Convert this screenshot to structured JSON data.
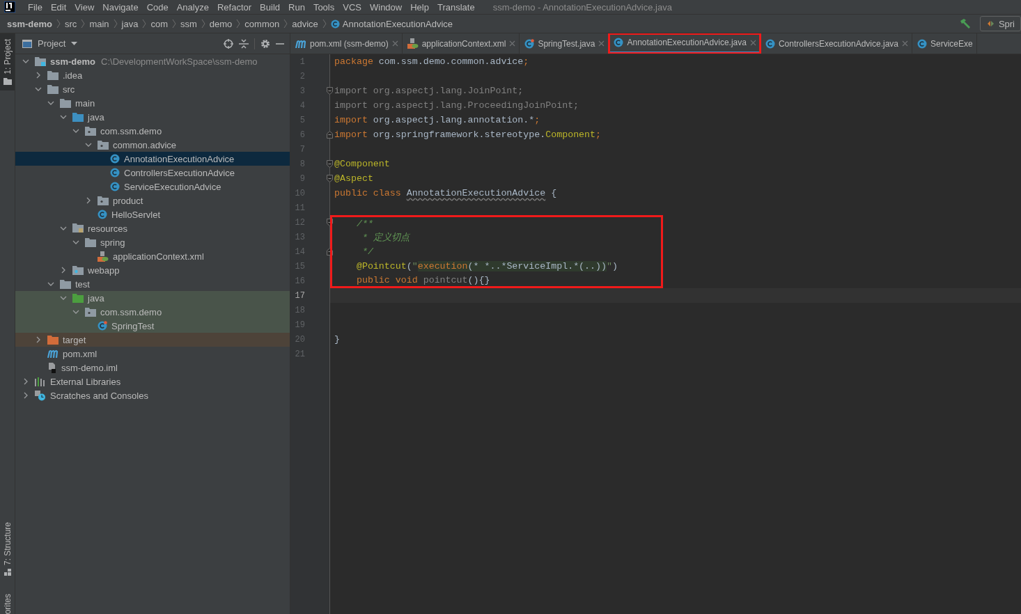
{
  "menu_bar": {
    "items": [
      "File",
      "Edit",
      "View",
      "Navigate",
      "Code",
      "Analyze",
      "Refactor",
      "Build",
      "Run",
      "Tools",
      "VCS",
      "Window",
      "Help",
      "Translate"
    ],
    "title": "ssm-demo - AnnotationExecutionAdvice.java"
  },
  "breadcrumbs": [
    {
      "label": "ssm-demo",
      "kind": "project"
    },
    {
      "label": "src",
      "kind": "dir"
    },
    {
      "label": "main",
      "kind": "dir"
    },
    {
      "label": "java",
      "kind": "dir"
    },
    {
      "label": "com",
      "kind": "dir"
    },
    {
      "label": "ssm",
      "kind": "dir"
    },
    {
      "label": "demo",
      "kind": "dir"
    },
    {
      "label": "common",
      "kind": "dir"
    },
    {
      "label": "advice",
      "kind": "dir"
    },
    {
      "label": "AnnotationExecutionAdvice",
      "kind": "class"
    }
  ],
  "toolbar": {
    "run_config": "Spri"
  },
  "tool_strip": {
    "top": [
      {
        "label": "1: Project",
        "selected": true
      }
    ],
    "bottom": [
      {
        "label": "7: Structure",
        "selected": false
      },
      {
        "label": "orites",
        "selected": false
      }
    ]
  },
  "project_panel": {
    "title": "Project",
    "tree": [
      {
        "label": "ssm-demo",
        "hint": "C:\\DevelopmentWorkSpace\\ssm-demo",
        "kind": "module",
        "expanded": true,
        "selected": false,
        "children": [
          {
            "label": ".idea",
            "kind": "folder",
            "expanded": false,
            "selected": false
          },
          {
            "label": "src",
            "kind": "folder",
            "expanded": true,
            "selected": false,
            "children": [
              {
                "label": "main",
                "kind": "folder",
                "expanded": true,
                "selected": false,
                "children": [
                  {
                    "label": "java",
                    "kind": "source-folder",
                    "expanded": true,
                    "selected": false,
                    "children": [
                      {
                        "label": "com.ssm.demo",
                        "kind": "package",
                        "expanded": true,
                        "selected": false,
                        "children": [
                          {
                            "label": "common.advice",
                            "kind": "package",
                            "expanded": true,
                            "selected": false,
                            "children": [
                              {
                                "label": "AnnotationExecutionAdvice",
                                "kind": "class",
                                "selected": true
                              },
                              {
                                "label": "ControllersExecutionAdvice",
                                "kind": "class",
                                "selected": false
                              },
                              {
                                "label": "ServiceExecutionAdvice",
                                "kind": "class",
                                "selected": false
                              }
                            ]
                          },
                          {
                            "label": "product",
                            "kind": "package",
                            "expanded": false,
                            "selected": false
                          },
                          {
                            "label": "HelloServlet",
                            "kind": "class",
                            "selected": false
                          }
                        ]
                      }
                    ]
                  },
                  {
                    "label": "resources",
                    "kind": "resources",
                    "expanded": true,
                    "selected": false,
                    "children": [
                      {
                        "label": "spring",
                        "kind": "folder",
                        "expanded": true,
                        "selected": false,
                        "children": [
                          {
                            "label": "applicationContext.xml",
                            "kind": "xml",
                            "selected": false
                          }
                        ]
                      }
                    ]
                  },
                  {
                    "label": "webapp",
                    "kind": "webapp",
                    "expanded": false,
                    "selected": false
                  }
                ]
              },
              {
                "label": "test",
                "kind": "folder",
                "expanded": true,
                "selected": false,
                "children": [
                  {
                    "label": "java",
                    "kind": "test-folder",
                    "test_scope": true,
                    "expanded": true,
                    "selected": false,
                    "children": [
                      {
                        "label": "com.ssm.demo",
                        "kind": "package",
                        "test_scope": true,
                        "expanded": true,
                        "selected": false,
                        "children": [
                          {
                            "label": "SpringTest",
                            "kind": "test-class",
                            "test_scope": true,
                            "selected": false
                          }
                        ]
                      }
                    ]
                  }
                ]
              }
            ]
          },
          {
            "label": "target",
            "kind": "excluded-folder",
            "excluded": true,
            "expanded": false,
            "selected": false
          },
          {
            "label": "pom.xml",
            "kind": "maven",
            "selected": false
          },
          {
            "label": "ssm-demo.iml",
            "kind": "iml",
            "selected": false
          }
        ]
      },
      {
        "label": "External Libraries",
        "kind": "libraries",
        "expanded": false,
        "selected": false
      },
      {
        "label": "Scratches and Consoles",
        "kind": "scratches",
        "expanded": false,
        "selected": false
      }
    ]
  },
  "tabs": [
    {
      "label": "pom.xml (ssm-demo)",
      "kind": "maven",
      "selected": false,
      "highlighted": false
    },
    {
      "label": "applicationContext.xml",
      "kind": "xml",
      "selected": false,
      "highlighted": false
    },
    {
      "label": "SpringTest.java",
      "kind": "test-class",
      "selected": false,
      "highlighted": false
    },
    {
      "label": "AnnotationExecutionAdvice.java",
      "kind": "class",
      "selected": true,
      "highlighted": true
    },
    {
      "label": "ControllersExecutionAdvice.java",
      "kind": "class",
      "selected": false,
      "highlighted": false
    },
    {
      "label": "ServiceExe",
      "kind": "class",
      "selected": false,
      "highlighted": false
    }
  ],
  "editor": {
    "lines": [
      {
        "number": "1",
        "current": false,
        "boxed": false,
        "tokens": [
          {
            "text": "package",
            "kind": "keyword"
          },
          {
            "text": " com.ssm.demo.common.advice",
            "kind": "plain"
          },
          {
            "text": ";",
            "kind": "keyword"
          }
        ]
      },
      {
        "number": "2",
        "current": false,
        "boxed": false
      },
      {
        "number": "3",
        "current": false,
        "boxed": false,
        "fold_start": true,
        "tokens": [
          {
            "text": "import org.aspectj.lang.JoinPoint;",
            "kind": "unused"
          }
        ]
      },
      {
        "number": "4",
        "current": false,
        "boxed": false,
        "tokens": [
          {
            "text": "import org.aspectj.lang.ProceedingJoinPoint;",
            "kind": "unused"
          }
        ]
      },
      {
        "number": "5",
        "current": false,
        "boxed": false,
        "tokens": [
          {
            "text": "import",
            "kind": "keyword"
          },
          {
            "text": " org.aspectj.lang.annotation.*",
            "kind": "plain"
          },
          {
            "text": ";",
            "kind": "keyword"
          }
        ]
      },
      {
        "number": "6",
        "current": false,
        "boxed": false,
        "fold_end": true,
        "tokens": [
          {
            "text": "import",
            "kind": "keyword"
          },
          {
            "text": " org.springframework.stereotype.",
            "kind": "plain"
          },
          {
            "text": "Component",
            "kind": "annotation"
          },
          {
            "text": ";",
            "kind": "keyword"
          }
        ]
      },
      {
        "number": "7",
        "current": false,
        "boxed": false
      },
      {
        "number": "8",
        "current": false,
        "boxed": false,
        "fold_start": true,
        "tokens": [
          {
            "text": "@Component",
            "kind": "annotation"
          }
        ]
      },
      {
        "number": "9",
        "current": false,
        "boxed": false,
        "fold_start": true,
        "tokens": [
          {
            "text": "@Aspect",
            "kind": "annotation"
          }
        ]
      },
      {
        "number": "10",
        "current": false,
        "boxed": false,
        "tokens": [
          {
            "text": "public class ",
            "kind": "keyword"
          },
          {
            "text": "AnnotationExecutionAdvice",
            "kind": "warning"
          },
          {
            "text": " {",
            "kind": "plain"
          }
        ]
      },
      {
        "number": "11",
        "current": false,
        "boxed": false
      },
      {
        "number": "12",
        "current": false,
        "boxed": true,
        "fold_start": true,
        "tokens": [
          {
            "text": "    /**",
            "kind": "comment"
          }
        ]
      },
      {
        "number": "13",
        "current": false,
        "boxed": true,
        "tokens": [
          {
            "text": "     * 定义切点",
            "kind": "comment"
          }
        ]
      },
      {
        "number": "14",
        "current": false,
        "boxed": true,
        "fold_end": true,
        "tokens": [
          {
            "text": "     */",
            "kind": "comment"
          }
        ]
      },
      {
        "number": "15",
        "current": false,
        "boxed": true,
        "tokens": [
          {
            "text": "    @Pointcut",
            "kind": "annotation"
          },
          {
            "text": "(",
            "kind": "plain"
          },
          {
            "text": "\"",
            "kind": "string"
          },
          {
            "text": "execution",
            "kind": "injected-keyword"
          },
          {
            "text": "(* *..*ServiceImpl.*(..))",
            "kind": "injected"
          },
          {
            "text": "\"",
            "kind": "string"
          },
          {
            "text": ")",
            "kind": "plain"
          }
        ]
      },
      {
        "number": "16",
        "current": false,
        "boxed": true,
        "tokens": [
          {
            "text": "    public void ",
            "kind": "keyword"
          },
          {
            "text": "pointcut",
            "kind": "unused"
          },
          {
            "text": "(){}",
            "kind": "plain"
          }
        ]
      },
      {
        "number": "17",
        "current": true,
        "boxed": false
      },
      {
        "number": "18",
        "current": false,
        "boxed": false
      },
      {
        "number": "19",
        "current": false,
        "boxed": false
      },
      {
        "number": "20",
        "current": false,
        "boxed": false,
        "tokens": [
          {
            "text": "}",
            "kind": "plain"
          }
        ]
      },
      {
        "number": "21",
        "current": false,
        "boxed": false
      }
    ]
  }
}
